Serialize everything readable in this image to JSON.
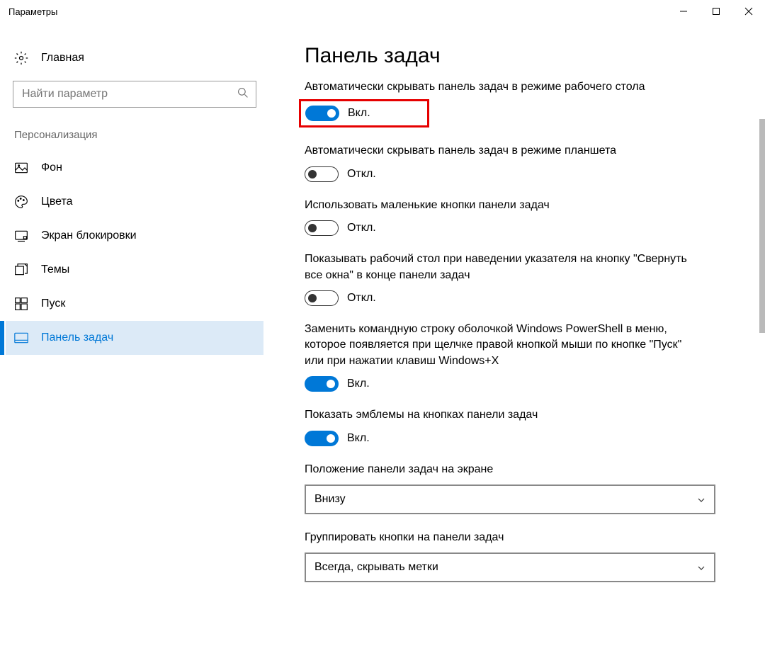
{
  "window": {
    "title": "Параметры"
  },
  "sidebar": {
    "home": "Главная",
    "search_placeholder": "Найти параметр",
    "group": "Персонализация",
    "items": [
      {
        "label": "Фон"
      },
      {
        "label": "Цвета"
      },
      {
        "label": "Экран блокировки"
      },
      {
        "label": "Темы"
      },
      {
        "label": "Пуск"
      },
      {
        "label": "Панель задач"
      }
    ]
  },
  "main": {
    "title": "Панель задач",
    "settings": [
      {
        "desc": "Автоматически скрывать панель задач в режиме рабочего стола",
        "state": "Вкл.",
        "on": true,
        "highlight": true
      },
      {
        "desc": "Автоматически скрывать панель задач в режиме планшета",
        "state": "Откл.",
        "on": false
      },
      {
        "desc": "Использовать маленькие кнопки панели задач",
        "state": "Откл.",
        "on": false
      },
      {
        "desc": "Показывать рабочий стол при наведении указателя на кнопку \"Свернуть все окна\" в конце панели задач",
        "state": "Откл.",
        "on": false
      },
      {
        "desc": "Заменить командную строку оболочкой Windows PowerShell в меню, которое появляется при щелчке правой кнопкой мыши по кнопке \"Пуск\" или при нажатии клавиш Windows+X",
        "state": "Вкл.",
        "on": true
      },
      {
        "desc": "Показать эмблемы на кнопках панели задач",
        "state": "Вкл.",
        "on": true
      }
    ],
    "dropdowns": [
      {
        "label": "Положение панели задач на экране",
        "value": "Внизу"
      },
      {
        "label": "Группировать кнопки на панели задач",
        "value": "Всегда, скрывать метки"
      }
    ]
  }
}
